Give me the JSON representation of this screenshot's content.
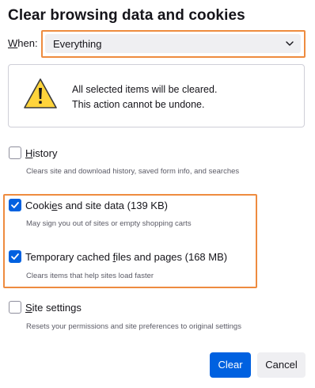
{
  "dialog": {
    "title": "Clear browsing data and cookies"
  },
  "when": {
    "label_accel": "W",
    "label_rest": "hen:",
    "selected": "Everything",
    "dropdown_icon": "chevron-down-icon"
  },
  "warning": {
    "icon": "warning-icon",
    "line1": "All selected items will be cleared.",
    "line2": "This action cannot be undone."
  },
  "options": [
    {
      "label_pre": "",
      "label_accel": "H",
      "label_post": "istory",
      "description": "Clears site and download history, saved form info, and searches",
      "checked": false
    },
    {
      "label_pre": "Cooki",
      "label_accel": "e",
      "label_post": "s and site data (139 KB)",
      "description": "May sign you out of sites or empty shopping carts",
      "checked": true
    },
    {
      "label_pre": "Temporary cached ",
      "label_accel": "f",
      "label_post": "iles and pages (168 MB)",
      "description": "Clears items that help sites load faster",
      "checked": true
    },
    {
      "label_pre": "",
      "label_accel": "S",
      "label_post": "ite settings",
      "description": "Resets your permissions and site preferences to original settings",
      "checked": false
    }
  ],
  "buttons": {
    "clear": "Clear",
    "cancel": "Cancel"
  },
  "colors": {
    "accent": "#0061e0",
    "highlight": "#ee8b3f",
    "warning_yellow": "#ffd43b"
  }
}
